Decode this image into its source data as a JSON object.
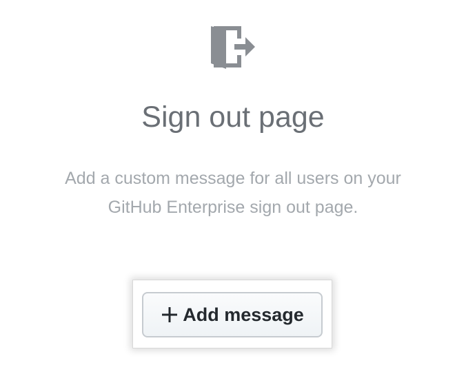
{
  "blankslate": {
    "icon": "sign-out-door-icon",
    "title": "Sign out page",
    "description": "Add a custom message for all users on your GitHub Enterprise sign out page."
  },
  "add_message_button": {
    "icon": "plus-icon",
    "label": "Add message"
  },
  "colors": {
    "icon": "#8a8e93",
    "title": "#6a6f75",
    "description": "#a3a8ad",
    "button_text": "#24292e",
    "button_border": "#c6cbd0"
  }
}
